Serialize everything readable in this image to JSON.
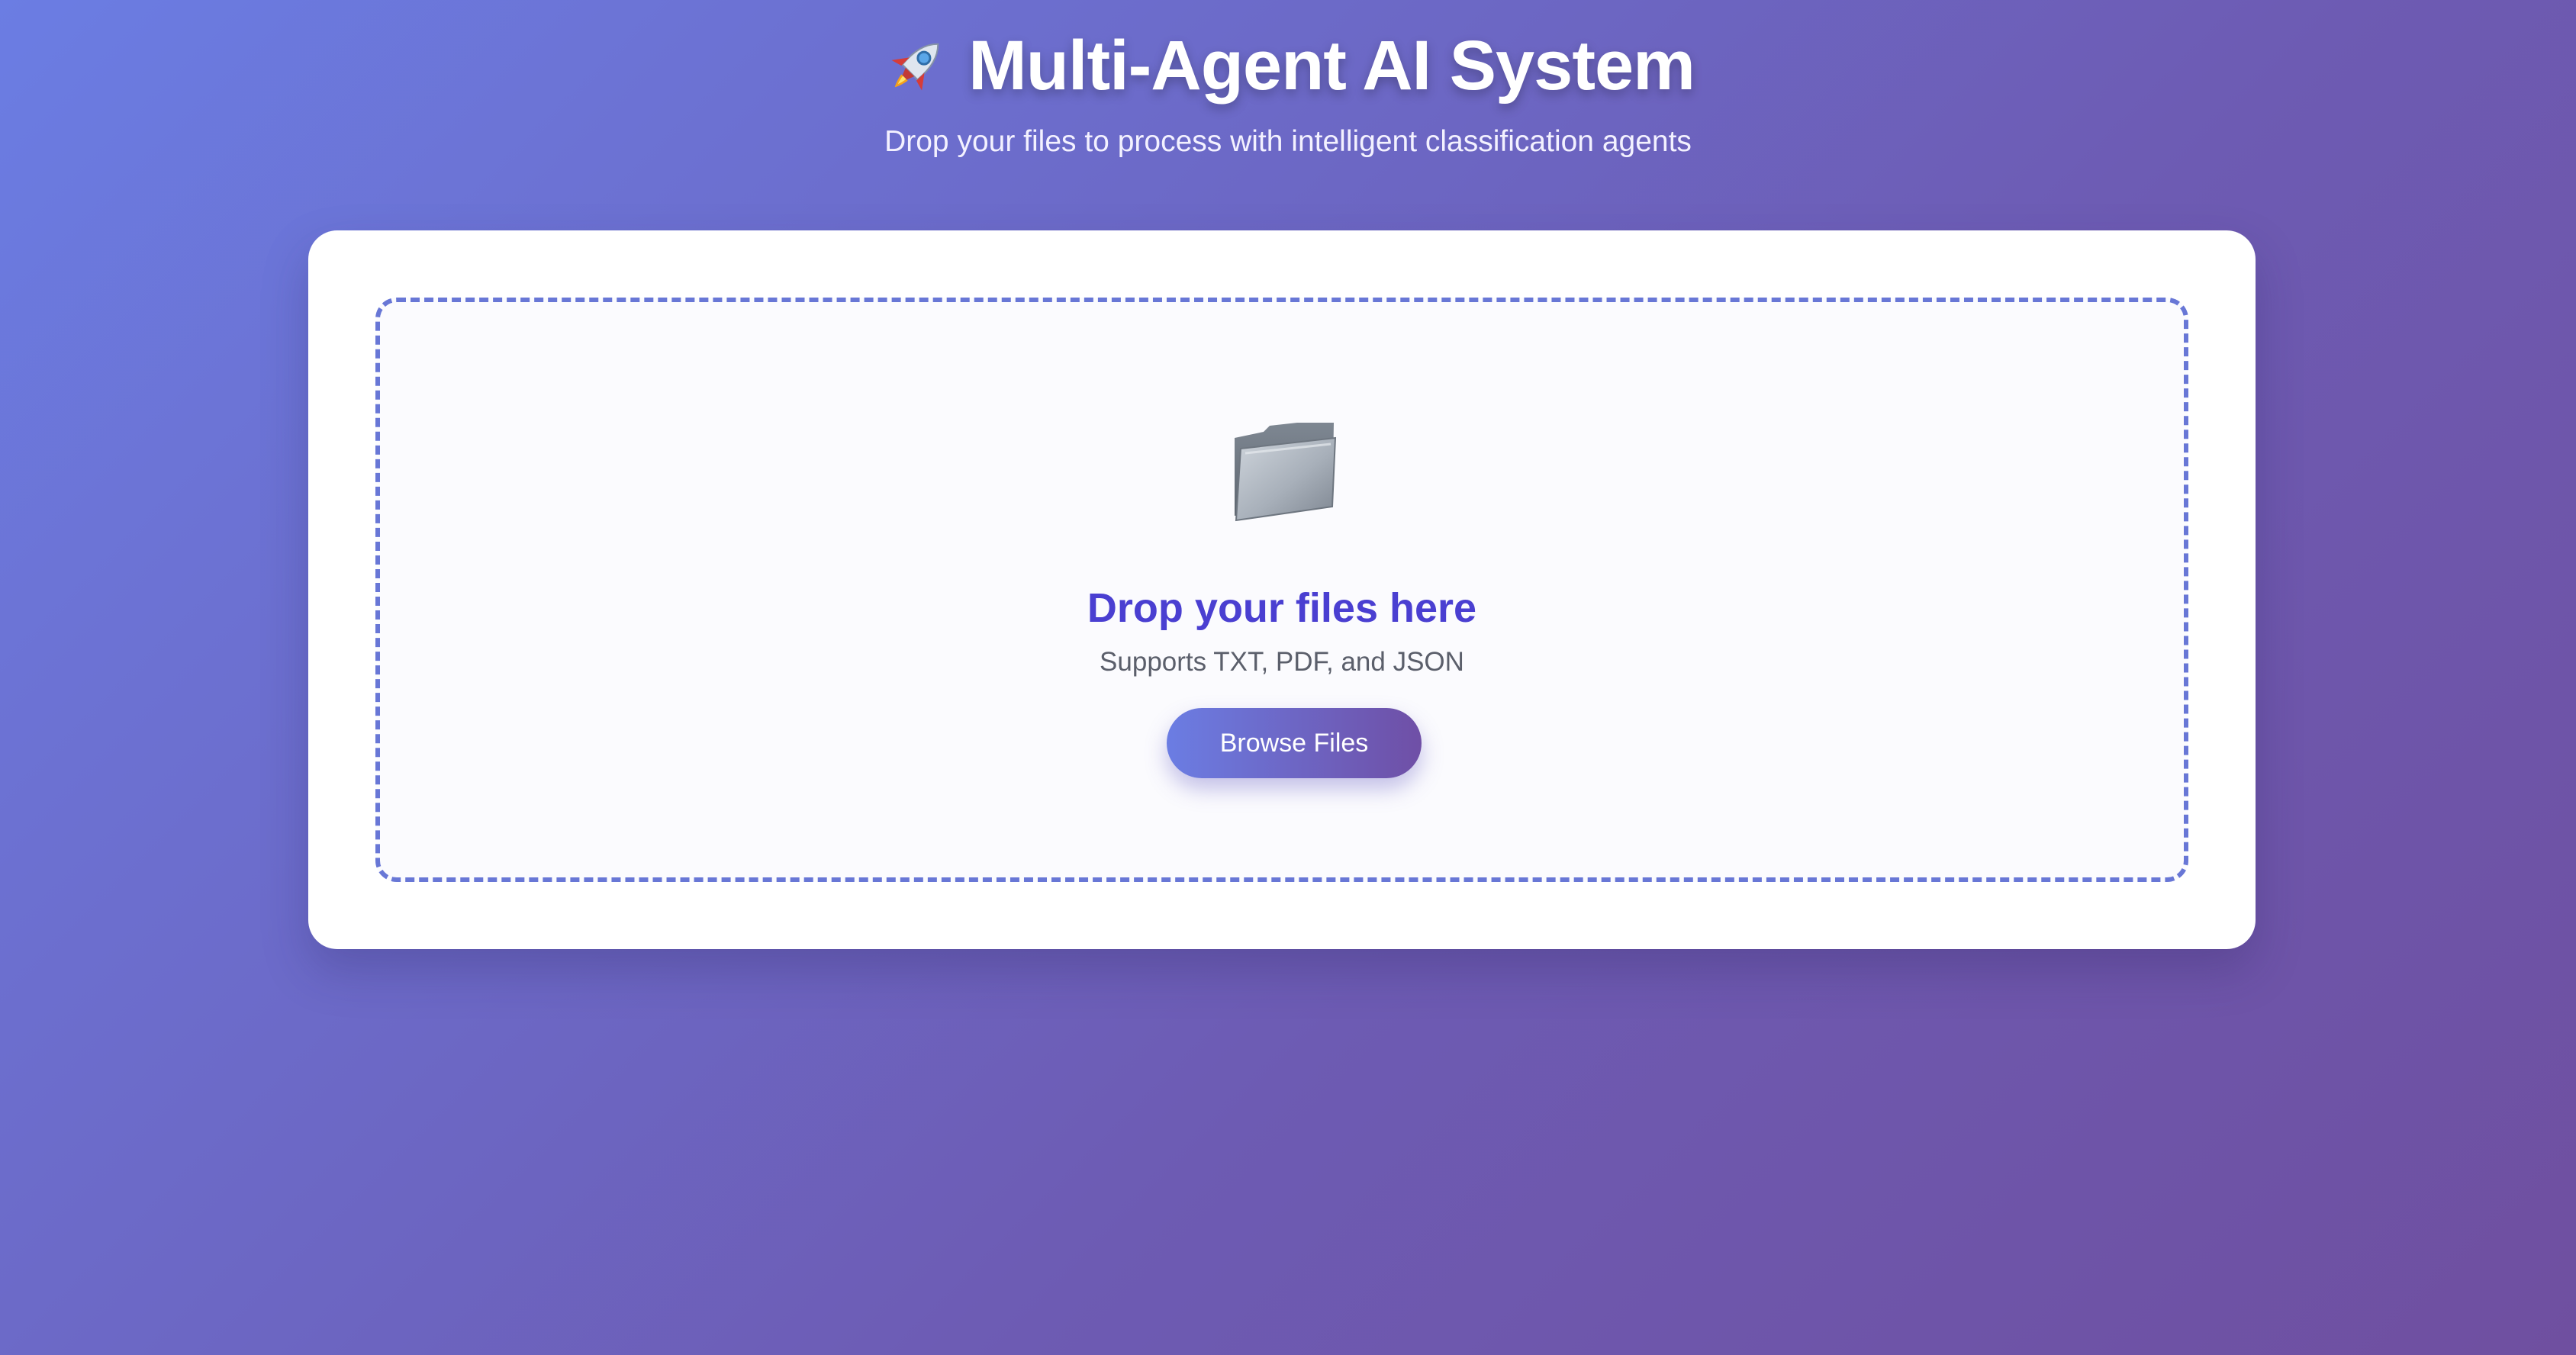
{
  "header": {
    "title": "Multi-Agent AI System",
    "title_icon": "rocket-icon",
    "subtitle": "Drop your files to process with intelligent classification agents"
  },
  "upload": {
    "icon": "folder-icon",
    "title": "Drop your files here",
    "hint": "Supports TXT, PDF, and JSON",
    "browse_label": "Browse Files"
  },
  "colors": {
    "background_start": "#6b7de3",
    "background_end": "#6f4fa0",
    "accent": "#4a3fd1",
    "dashed_border": "#6877d6",
    "card": "#ffffff"
  }
}
